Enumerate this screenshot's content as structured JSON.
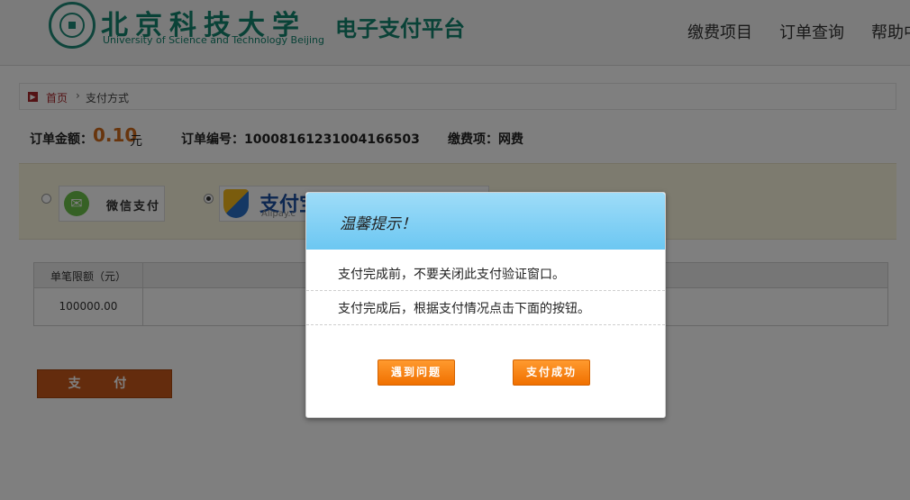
{
  "header": {
    "university_cn": "北京科技大学",
    "university_en": "University of Science and Technology Beijing",
    "platform": "电子支付平台",
    "nav": [
      "缴费项目",
      "订单查询",
      "帮助中"
    ]
  },
  "breadcrumb": {
    "home": "首页",
    "separator": "›",
    "current": "支付方式"
  },
  "order": {
    "amount_label": "订单金额：",
    "amount": "0.10",
    "amount_unit": "元",
    "order_no_label": "订单编号：",
    "order_no": "10008161231004166503",
    "item_label": "缴费项：",
    "item": "网费"
  },
  "methods": [
    {
      "name": "微信支付",
      "selected": false,
      "icon": "wechat-icon"
    },
    {
      "name": "支付宝",
      "sub": "Alipay.c",
      "selected": true,
      "icon": "alipay-shield-icon"
    }
  ],
  "table": {
    "header": "单笔限额（元）",
    "value": "100000.00"
  },
  "pay_button": "支 付",
  "modal": {
    "title": "温馨提示！",
    "message_1": "支付完成前，不要关闭此支付验证窗口。",
    "message_2": "支付完成后，根据支付情况点击下面的按钮。",
    "problem_button": "遇到问题",
    "success_button": "支付成功"
  },
  "colors": {
    "brand_green": "#12846f",
    "accent_orange": "#f07000",
    "amount_orange": "#d06a1a",
    "modal_header": "#6cc7f2"
  }
}
